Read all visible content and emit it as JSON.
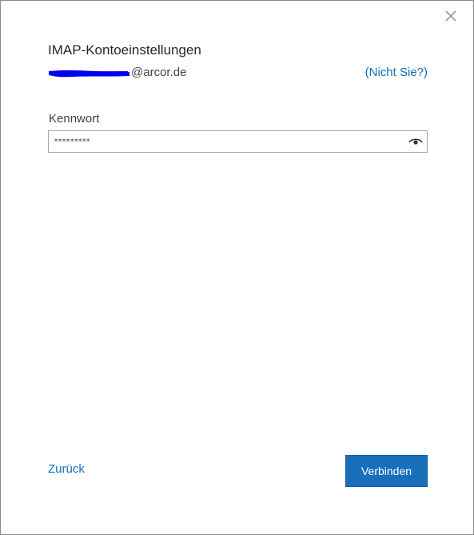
{
  "dialog": {
    "title": "IMAP-Kontoeinstellungen",
    "close_icon": "close-icon"
  },
  "account": {
    "email_visible_part": "@arcor.de",
    "not_you_label": "(Nicht Sie?)",
    "redaction_color": "#0000ee"
  },
  "password": {
    "label": "Kennwort",
    "value": "*********",
    "reveal_icon": "eye-icon"
  },
  "footer": {
    "back_label": "Zurück",
    "connect_label": "Verbinden"
  },
  "colors": {
    "accent": "#106ebe",
    "primary_button": "#1a6fba"
  }
}
